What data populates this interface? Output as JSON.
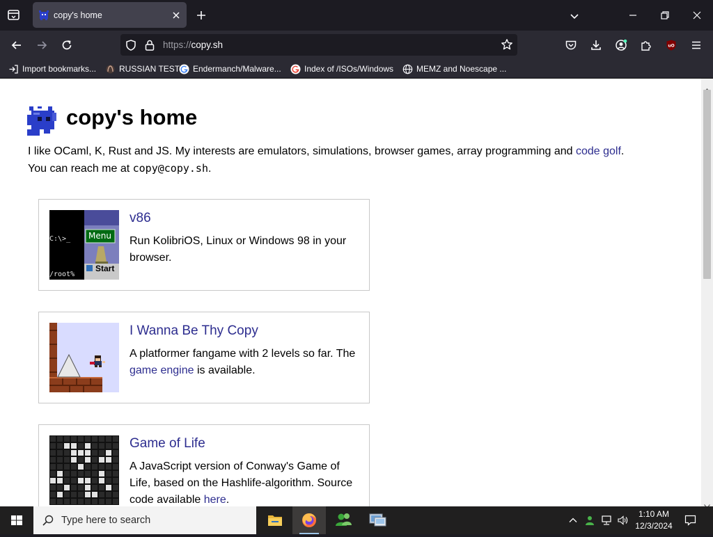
{
  "browser": {
    "tab_title": "copy's home",
    "url_prefix": "https://",
    "url_host": "copy.sh",
    "bookmarks": [
      {
        "label": "Import bookmarks...",
        "icon": "import-icon"
      },
      {
        "label": "RUSSIAN TEST",
        "icon": "site-icon"
      },
      {
        "label": "Endermanch/Malware...",
        "icon": "google-icon"
      },
      {
        "label": "Index of /ISOs/Windows",
        "icon": "google-icon"
      },
      {
        "label": "MEMZ and Noescape ...",
        "icon": "globe-icon"
      }
    ]
  },
  "page": {
    "title": "copy's home",
    "intro_line1": "I like OCaml, K, Rust and JS. My interests are emulators, simulations, browser games, array programming and ",
    "intro_link": "code golf",
    "intro_line1_end": ".",
    "intro_line2": "You can reach me at ",
    "email": "copy@copy.sh",
    "intro_line2_end": ".",
    "projects": [
      {
        "title": "v86",
        "desc": "Run KolibriOS, Linux or Windows 98 in your browser.",
        "thumb_prompt": "C:\\>_",
        "thumb_root": "/root%",
        "thumb_menu": "Menu",
        "thumb_start": "Start"
      },
      {
        "title": "I Wanna Be Thy Copy",
        "desc_pre": "A platformer fangame with 2 levels so far. The ",
        "desc_link": "game engine",
        "desc_post": " is available."
      },
      {
        "title": "Game of Life",
        "desc_pre": "A JavaScript version of Conway's Game of Life, based on the Hashlife-algorithm. Source code available ",
        "desc_link": "here",
        "desc_post": "."
      }
    ]
  },
  "taskbar": {
    "search_placeholder": "Type here to search",
    "time": "1:10 AM",
    "date": "12/3/2024"
  },
  "colors": {
    "link": "#2d2d8f",
    "brand_blue": "#2a3ec9",
    "chrome_dark": "#1c1b22",
    "chrome_mid": "#2b2a33"
  }
}
